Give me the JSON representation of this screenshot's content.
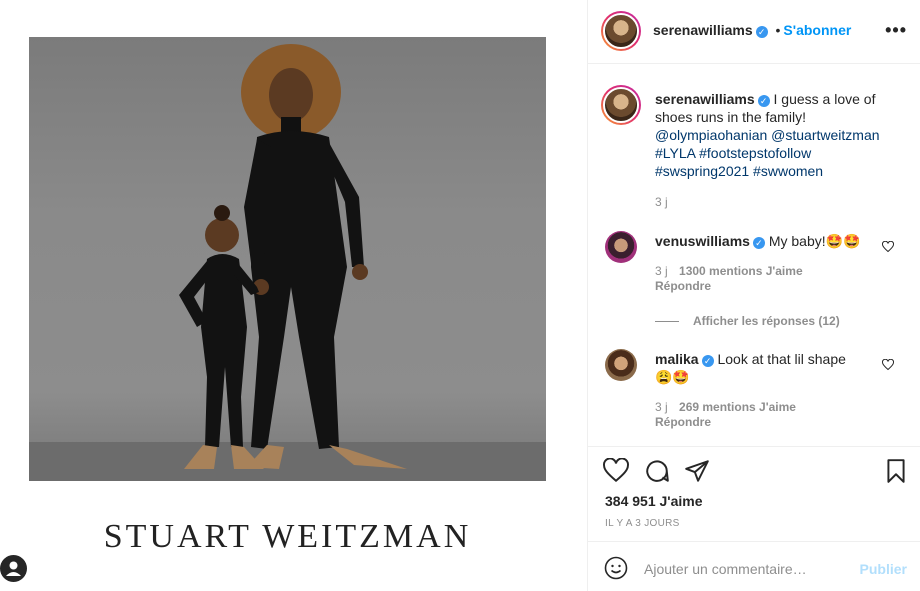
{
  "media": {
    "brand_text": "STUART WEITZMAN"
  },
  "header": {
    "username": "serenawilliams",
    "separator": "•",
    "follow_label": "S'abonner",
    "more_label": "•••"
  },
  "caption": {
    "username": "serenawilliams",
    "text": "I guess a love of shoes runs in the family!",
    "mentions": [
      "@olympiaohanian",
      "@stuartweitzman"
    ],
    "hashtags_line1": "#LYLA #footstepstofollow",
    "hashtags_line2": "#swspring2021 #swwomen",
    "time": "3 j"
  },
  "comments": [
    {
      "username": "venuswilliams",
      "text": "My baby!🤩🤩",
      "time": "3 j",
      "likes": "1300 mentions J'aime",
      "reply": "Répondre",
      "view_replies": "Afficher les réponses (12)"
    },
    {
      "username": "malika",
      "text": "Look at that lil shape",
      "text2": "😩🤩",
      "time": "3 j",
      "likes": "269 mentions J'aime",
      "reply": "Répondre"
    }
  ],
  "actions": {
    "likes_count": "384 951 J'aime",
    "posted_ago": "IL Y A 3 JOURS"
  },
  "add_comment": {
    "placeholder": "Ajouter un commentaire…",
    "publish_label": "Publier"
  },
  "colors": {
    "accent": "#0095f6",
    "verified": "#3897f0",
    "muted": "#8e8e8e",
    "tag": "#00376b"
  }
}
